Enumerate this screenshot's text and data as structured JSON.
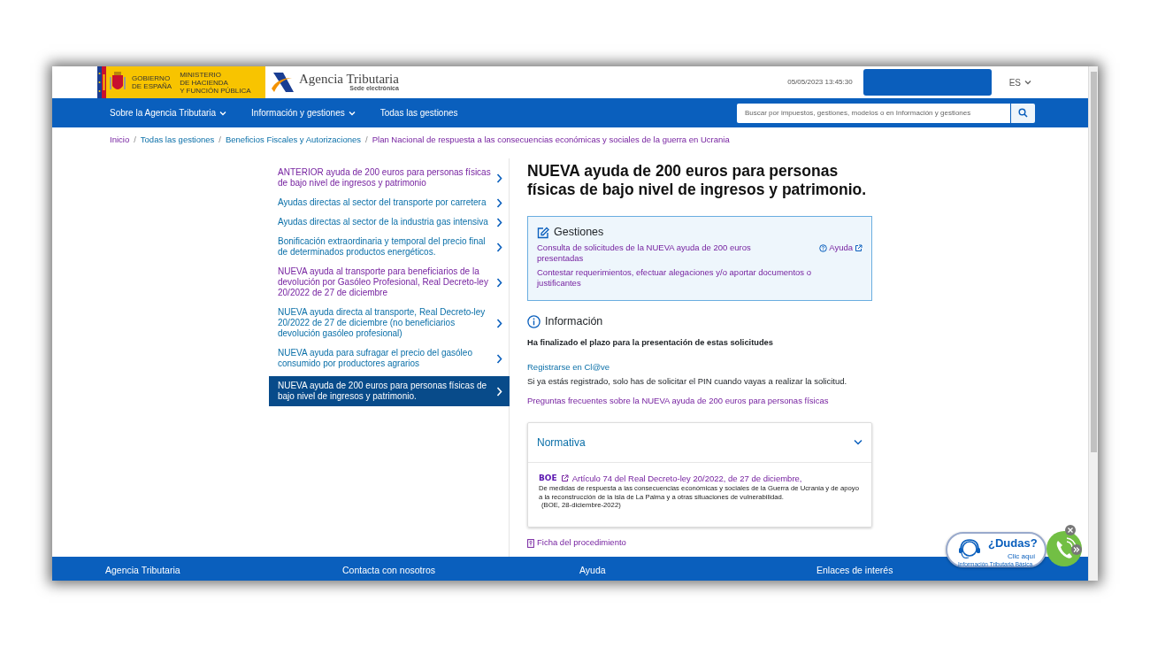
{
  "header": {
    "gov_logo": {
      "line_1": "GOBIERNO",
      "line_2": "DE ESPAÑA",
      "ministry_1": "MINISTERIO",
      "ministry_2": "DE HACIENDA",
      "ministry_3": "Y FUNCIÓN PÚBLICA"
    },
    "agency_name": "Agencia Tributaria",
    "agency_subtitle": "Sede electrónica",
    "datetime": "05/05/2023 13:45:30",
    "language": "ES"
  },
  "nav": {
    "items": [
      {
        "label": "Sobre la Agencia Tributaria",
        "dropdown": true
      },
      {
        "label": "Información y gestiones",
        "dropdown": true
      },
      {
        "label": "Todas las gestiones",
        "dropdown": false
      }
    ],
    "search": {
      "placeholder": "Buscar por impuestos, gestiones, modelos o en Información y gestiones"
    }
  },
  "breadcrumb": [
    {
      "label": "Inicio",
      "visited": true
    },
    {
      "separator": "/",
      "label": "Todas las gestiones",
      "visited": false
    },
    {
      "separator": "/",
      "label": "Beneficios Fiscales y Autorizaciones",
      "visited": false
    },
    {
      "separator": "/",
      "label": "Plan Nacional de respuesta a las consecuencias económicas y sociales de la guerra en Ucrania",
      "visited": true
    }
  ],
  "sidebar": {
    "items": [
      {
        "label": "ANTERIOR ayuda de 200 euros para personas físicas de bajo nivel de ingresos y patrimonio",
        "visited": true,
        "selected": false
      },
      {
        "label": "Ayudas directas al sector del transporte por carretera",
        "visited": false,
        "selected": false
      },
      {
        "label": "Ayudas directas al sector de la industria gas intensiva",
        "visited": false,
        "selected": false
      },
      {
        "label": "Bonificación extraordinaria y temporal del precio final de determinados productos energéticos.",
        "visited": false,
        "selected": false
      },
      {
        "label": "NUEVA ayuda al transporte para beneficiarios de la devolución por Gasóleo Profesional, Real Decreto-ley 20/2022 de 27 de diciembre",
        "visited": true,
        "selected": false
      },
      {
        "label": "NUEVA ayuda directa al transporte, Real Decreto-ley 20/2022 de 27 de diciembre (no beneficiarios devolución gasóleo profesional)",
        "visited": false,
        "selected": false
      },
      {
        "label": "NUEVA ayuda para sufragar el precio del gasóleo consumido por productores agrarios",
        "visited": false,
        "selected": false
      },
      {
        "label": "NUEVA ayuda de 200 euros para personas físicas de bajo nivel de ingresos y patrimonio.",
        "selected": true
      }
    ]
  },
  "main": {
    "title": "NUEVA ayuda de 200 euros para personas físicas de bajo nivel de ingresos y patrimonio.",
    "gestiones": {
      "heading": "Gestiones",
      "help": "Ayuda",
      "links": [
        {
          "label": "Consulta de solicitudes de la NUEVA ayuda de 200 euros presentadas",
          "visited": true
        },
        {
          "label": "Contestar requerimientos, efectuar alegaciones y/o aportar documentos o justificantes",
          "visited": true
        }
      ]
    },
    "information": {
      "heading": "Información",
      "notice": "Ha finalizado el plazo para la presentación de estas solicitudes",
      "register_link": "Registrarse en Cl@ve",
      "register_note": "Si ya estás registrado, solo has de solicitar el PIN cuando vayas a realizar la solicitud.",
      "faq_link": "Preguntas frecuentes sobre la NUEVA ayuda de 200 euros para personas físicas"
    },
    "normativa": {
      "title": "Normativa",
      "expanded": true,
      "source": "BOE",
      "link": "Artículo 74 del Real Decreto-ley 20/2022, de 27 de diciembre,",
      "description": "De medidas de respuesta a las consecuencias económicas y sociales de la Guerra de Ucrania y de apoyo a la reconstrucción de la isla de La Palma y a otras situaciones de vulnerabilidad.",
      "citation": "(BOE, 28-diciembre-2022)"
    },
    "procedure_link": "Ficha del procedimiento"
  },
  "footer": [
    "Agencia Tributaria",
    "Contacta con nosotros",
    "Ayuda",
    "Enlaces de interés"
  ],
  "help_widget": {
    "title": "¿Dudas?",
    "cta": "Clic aquí",
    "subtitle": "Información Tributaria Básica"
  }
}
